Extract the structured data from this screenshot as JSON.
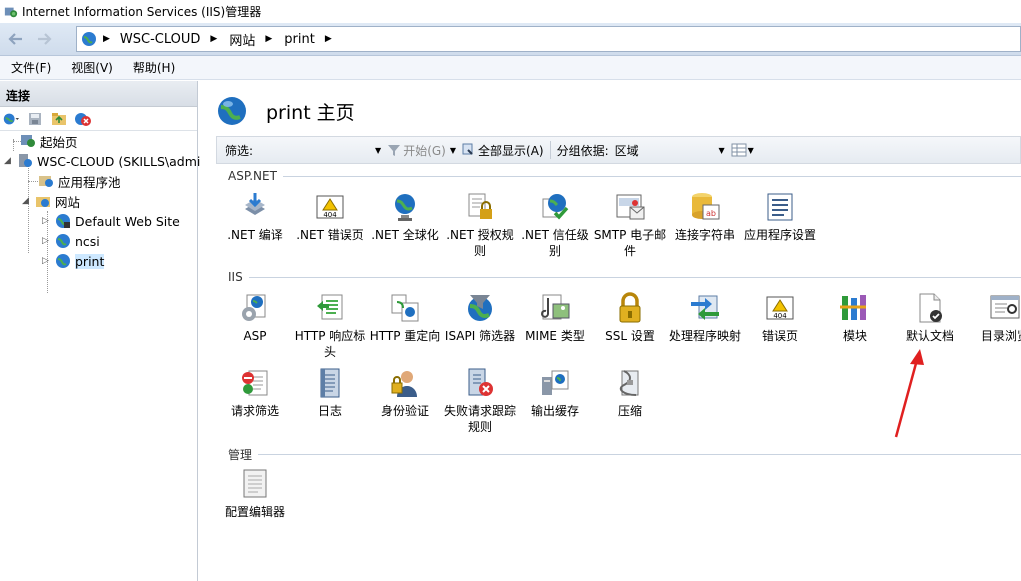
{
  "window": {
    "title": "Internet Information Services (IIS)管理器"
  },
  "address": {
    "crumbs": [
      "WSC-CLOUD",
      "网站",
      "print"
    ]
  },
  "menu": {
    "items": [
      "文件(F)",
      "视图(V)",
      "帮助(H)"
    ]
  },
  "connections": {
    "title": "连接",
    "tree": [
      {
        "label": "起始页"
      },
      {
        "label": "WSC-CLOUD (SKILLS\\admi"
      },
      {
        "label": "应用程序池"
      },
      {
        "label": "网站"
      },
      {
        "label": "Default Web Site"
      },
      {
        "label": "ncsi"
      },
      {
        "label": "print"
      }
    ]
  },
  "page": {
    "title": "print 主页",
    "filter": {
      "label": "筛选:",
      "start": "开始(G)",
      "show_all": "全部显示(A)",
      "group_by": "分组依据:",
      "group_value": "区域"
    },
    "sections": {
      "aspnet": "ASP.NET",
      "iis": "IIS",
      "manage": "管理"
    },
    "aspnet_features": [
      {
        "label": ".NET 编译",
        "icon": "download-icon"
      },
      {
        "label": ".NET 错误页",
        "icon": "warning-404-icon"
      },
      {
        "label": ".NET 全球化",
        "icon": "globe-icon"
      },
      {
        "label": ".NET 授权规则",
        "icon": "lock-doc-icon"
      },
      {
        "label": ".NET 信任级别",
        "icon": "globe-check-icon"
      },
      {
        "label": "SMTP 电子邮件",
        "icon": "mail-icon"
      },
      {
        "label": "连接字符串",
        "icon": "database-icon"
      },
      {
        "label": "应用程序设置",
        "icon": "list-icon"
      }
    ],
    "iis_features_row1": [
      {
        "label": "ASP",
        "icon": "asp-icon"
      },
      {
        "label": "HTTP 响应标头",
        "icon": "http-headers-icon"
      },
      {
        "label": "HTTP 重定向",
        "icon": "redirect-icon"
      },
      {
        "label": "ISAPI 筛选器",
        "icon": "isapi-icon"
      },
      {
        "label": "MIME 类型",
        "icon": "mime-icon"
      },
      {
        "label": "SSL 设置",
        "icon": "padlock-icon"
      },
      {
        "label": "处理程序映射",
        "icon": "handler-icon"
      },
      {
        "label": "错误页",
        "icon": "warning-404-icon"
      },
      {
        "label": "模块",
        "icon": "modules-icon"
      },
      {
        "label": "默认文档",
        "icon": "default-doc-icon"
      },
      {
        "label": "目录浏览",
        "icon": "directory-browse-icon"
      }
    ],
    "iis_features_row2": [
      {
        "label": "请求筛选",
        "icon": "request-filter-icon"
      },
      {
        "label": "日志",
        "icon": "log-icon"
      },
      {
        "label": "身份验证",
        "icon": "user-icon"
      },
      {
        "label": "失败请求跟踪规则",
        "icon": "failed-request-icon"
      },
      {
        "label": "输出缓存",
        "icon": "output-cache-icon"
      },
      {
        "label": "压缩",
        "icon": "compress-icon"
      }
    ],
    "manage_features": [
      {
        "label": "配置编辑器",
        "icon": "config-editor-icon"
      }
    ]
  },
  "colors": {
    "accent": "#1f6fbf",
    "annotation": "#e02020"
  }
}
